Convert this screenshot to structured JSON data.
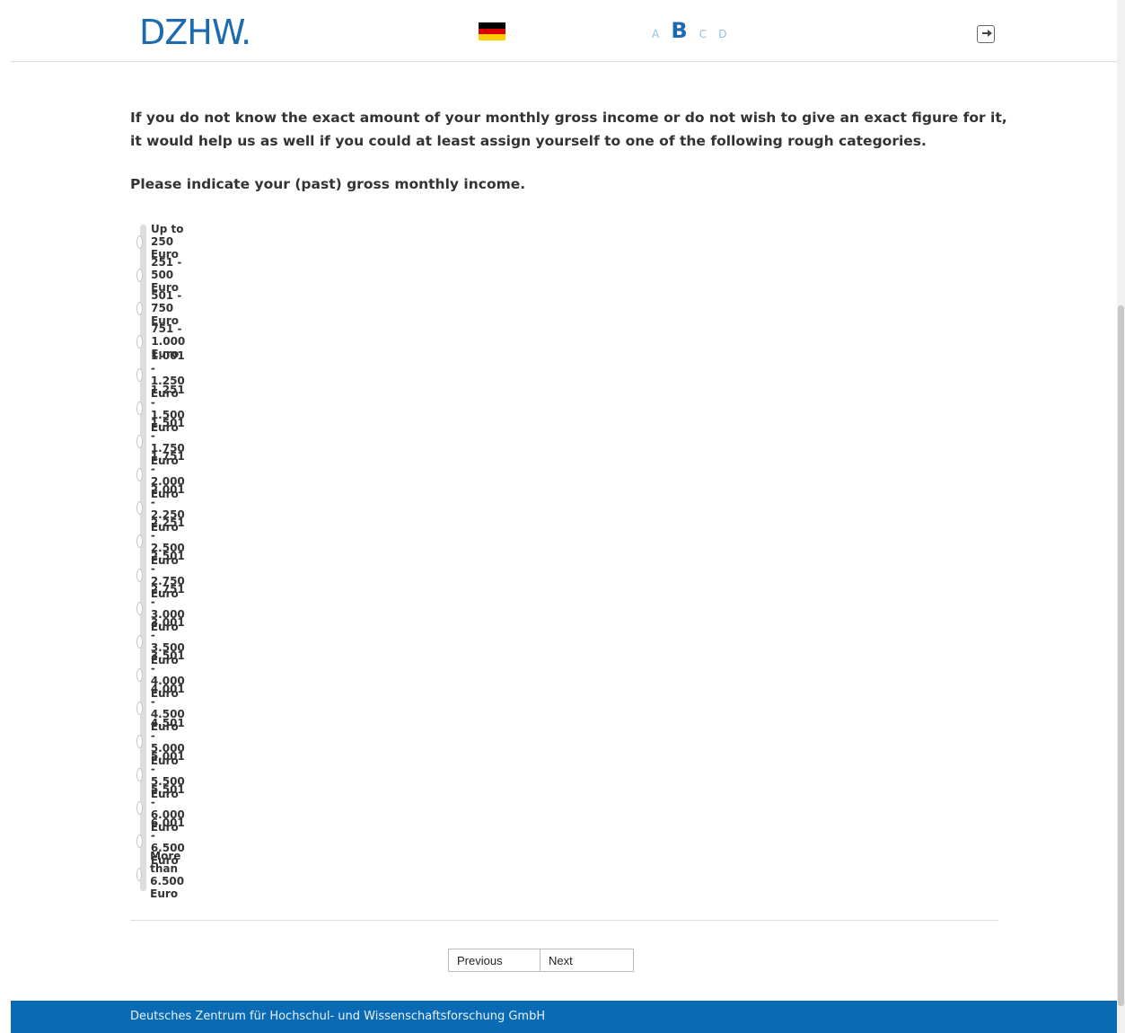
{
  "header": {
    "logo": "DZHW.",
    "flag_colors": [
      "#000000",
      "#dd0000",
      "#ffce00"
    ],
    "font_size_options": [
      "A",
      "B",
      "C",
      "D"
    ],
    "selected_font_size": "B"
  },
  "question": {
    "text": "If you do not know the exact amount of your monthly gross income or do not wish to give an exact figure for it, it would help us as well if you could at least assign yourself to one of the following rough categories.",
    "instruction": "Please indicate your (past) gross monthly income."
  },
  "options": [
    "Up to 250 Euro",
    "251 - 500 Euro",
    "501 - 750 Euro",
    "751 - 1.000 Euro",
    "1.001 - 1.250 Euro",
    "1.251 - 1.500 Euro",
    "1.501 - 1.750 Euro",
    "1.751 - 2.000 Euro",
    "2.001 - 2.250 Euro",
    "2.251 - 2.500 Euro",
    "2.501 - 2.750 Euro",
    "2.751 - 3.000 Euro",
    "3.001 - 3.500 Euro",
    "3.501 - 4.000 Euro",
    "4.001 - 4.500 Euro",
    "4.501 - 5.000 Euro",
    "5.001 - 5.500 Euro",
    "5.501 - 6.000 Euro",
    "6.001 - 6.500 Euro",
    "More than 6.500 Euro"
  ],
  "nav": {
    "previous_label": "Previous",
    "next_label": "Next"
  },
  "footer": {
    "text": "Deutsches Zentrum für Hochschul- und Wissenschaftsforschung GmbH",
    "color": "#0a6ab4"
  }
}
